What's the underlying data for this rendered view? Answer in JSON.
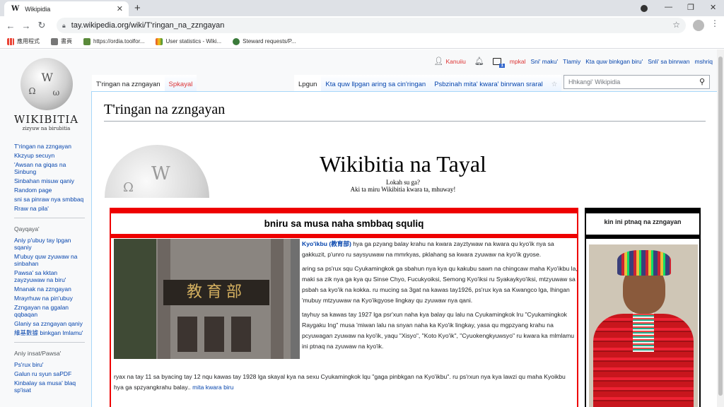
{
  "browser": {
    "tab_title": "Wikipidia",
    "favicon": "W",
    "url": "tay.wikipedia.org/wiki/T'ringan_na_zzngayan",
    "bookmarks": [
      {
        "label": "應用程式",
        "icon": "apps-grid-icon",
        "color": "#ea4335"
      },
      {
        "label": "書頁",
        "icon": "bookmark-icon",
        "color": "#777777"
      },
      {
        "label": "https://ordia.toolfor...",
        "icon": "ordia-icon",
        "color": "#5a8a3a"
      },
      {
        "label": "User statistics - Wiki...",
        "icon": "wikimedia-icon",
        "color": "#e34c26"
      },
      {
        "label": "Steward requests/P...",
        "icon": "meta-icon",
        "color": "#3a7a3a"
      }
    ]
  },
  "wiki": {
    "logo_wordmark": "WIKIBITIA",
    "logo_tagline": "zizyuw na birubitia",
    "personal": {
      "login": "Kanuiiu",
      "notification_count": "1",
      "links": [
        "mpkal",
        "Sni' maku'",
        "Tlamiy",
        "Kta quw binkgan biru'",
        "Snli' sa binrwan",
        "mshriq"
      ]
    },
    "tabs_left": [
      "T'ringan na zzngayan",
      "Spkayal"
    ],
    "tabs_right": [
      "Lpgun",
      "Kta quw llpgan aring sa cin'ringan",
      "Psbzinah mita' kwara' binrwan sraral"
    ],
    "search_placeholder": "Hhkangi' Wikipidia",
    "sidebar": {
      "nav": [
        "T'ringan na zzngayan",
        "Kkzyup secuyn",
        "'Awsan na giqas na Sinbung",
        "Sinbahan misuw qaniy",
        "Random page",
        "sni sa pinraw nya smbbaq",
        "Rraw na pila'"
      ],
      "section2_title": "Qayqaya'",
      "section2": [
        "Aniy p'ubuy tay lpgan sqaniy",
        "M'ubuy quw zyuwaw na sinbahan",
        "Pawsa' sa kktan zayzyuwaw na biru'",
        "Mnanak na zzngayan",
        "Mrayrhuw na pin'ubuy",
        "Zzngayan na ggalan qqbaqan",
        "Glaniy sa zzngayan qaniy",
        "維基數據 binkgan lmlamu'"
      ],
      "section3_title": "Aniy insat/Pawsa'",
      "section3": [
        "Ps'rux biru'",
        "Galun ru syun saPDF",
        "Kinbalay sa musa' blaq sp'isat"
      ]
    },
    "page_title": "T'ringan na zzngayan",
    "welcome_title": "Wikibitia na Tayal",
    "welcome_line1": "Lokah su ga?",
    "welcome_line2": "Aki ta miru Wikibitia kwara ta, mhuway!",
    "main_box_title": "bniru sa musa naha smbbaq squliq",
    "photo_sign": "教育部",
    "article_title_link": "Kyo'ikbu (教育部)",
    "article_p1": " hya ga pzyang balay krahu na kwara zayztywaw na kwara qu kyo'ik nya sa gakkuzit, p'unro ru saysyuwaw na mmrkyas, pklahang sa kwara zyuwaw na kyo'ik gyose.",
    "article_p2": "aring sa ps'rux squ Cyukamingkok ga sbahun nya kya qu kakubu sawn na chingcaw maha Kyo'ikbu la, maki sa zik nya ga kya qu Sinse Chyo, Fucukyoiksi, Semong Kyo'iksi ru Syakaykyo'iksi, mtzyuwaw sa psbah sa kyo'ik na kokka. ru mucing sa 3gat na kawas tay1926, ps'rux kya sa Kwangco lga, lhingan 'mubuy mtzyuwaw na Kyo'ikgyose lingkay qu zyuwaw nya qani.",
    "article_p3": "tayhuy sa kawas tay 1927 lga psr'xun naha kya balay qu lalu na Cyukamingkok lru \"Cyukamingkok Raygaku Ing\" musa 'miwan lalu na snyan naha ka Kyo'ik lingkay, yasa qu mgpzyang krahu na pcyuwagan zyuwaw na kyo'ik, yaqu \"Xisyo\", \"Koto Kyo'ik\", \"Cyuokengkyuwsyo\" ru kwara ka mlmlamu ini ptnaq na zyuwaw na kyo'ik.",
    "article_p4": "ryax na tay 11 sa byacing tay 12 nqu kawas tay 1928 lga skayal kya na sexu Cyukamingkok lqu \"gaga pinbkgan na Kyo'ikbu\". ru ps'rxun nya kya lawzi qu maha Kyoikbu hya ga spzyangkrahu balay..",
    "article_more": " mita kwara biru",
    "side_box_title": "kin ini ptnaq na zzngayan"
  }
}
